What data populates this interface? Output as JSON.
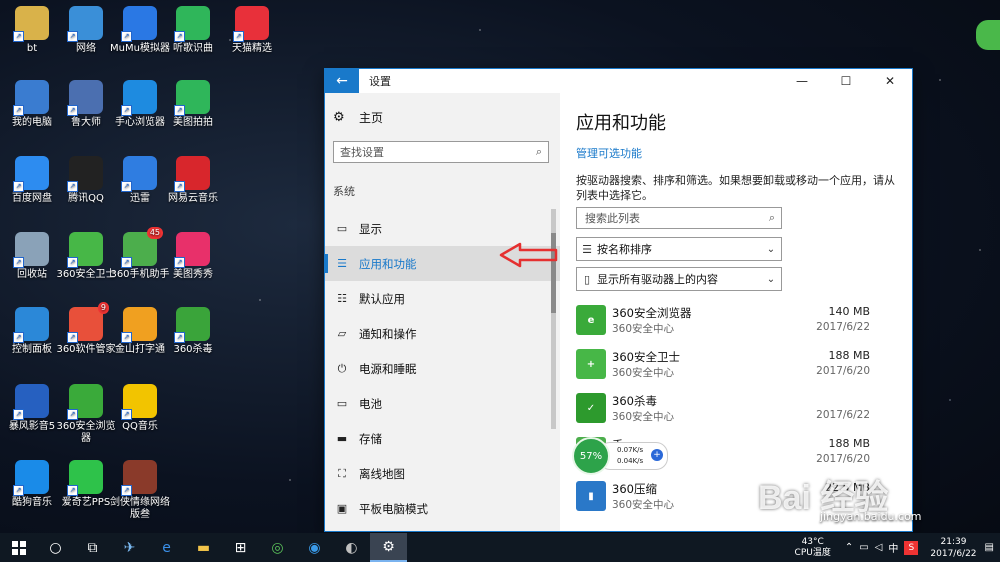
{
  "desktop_icons": [
    {
      "label": "bt",
      "color": "#d9b24a",
      "x": 0,
      "y": 0
    },
    {
      "label": "网络",
      "color": "#3a8fd8"
    },
    {
      "label": "MuMu模拟器",
      "color": "#2a78e4"
    },
    {
      "label": "听歌识曲",
      "color": "#2fb65a"
    },
    {
      "label": "天猫精选",
      "color": "#e8303a"
    },
    {
      "label": "我的电脑",
      "color": "#3a7cd0"
    },
    {
      "label": "鲁大师",
      "color": "#4b6fb0"
    },
    {
      "label": "手心浏览器",
      "color": "#1e8be0"
    },
    {
      "label": "美图拍拍",
      "color": "#2fb65a"
    },
    {
      "label": "百度网盘",
      "color": "#2d8cf0"
    },
    {
      "label": "腾讯QQ",
      "color": "#222222"
    },
    {
      "label": "迅雷",
      "color": "#2f7de1"
    },
    {
      "label": "网易云音乐",
      "color": "#d8262c"
    },
    {
      "label": "回收站",
      "color": "#8aa2b8"
    },
    {
      "label": "360安全卫士",
      "color": "#47b747"
    },
    {
      "label": "360手机助手",
      "color": "#4cae4c",
      "badge": "45"
    },
    {
      "label": "美图秀秀",
      "color": "#e8306a"
    },
    {
      "label": "控制面板",
      "color": "#2b88d8"
    },
    {
      "label": "360软件管家",
      "color": "#e8503a",
      "badge": "9"
    },
    {
      "label": "金山打字通",
      "color": "#f0a020"
    },
    {
      "label": "360杀毒",
      "color": "#3aa43a"
    },
    {
      "label": "暴风影音5",
      "color": "#2660c0"
    },
    {
      "label": "360安全浏览器",
      "color": "#3aaa3a"
    },
    {
      "label": "QQ音乐",
      "color": "#f2c400"
    },
    {
      "label": "酷狗音乐",
      "color": "#1a8be8"
    },
    {
      "label": "爱奇艺PPS",
      "color": "#2ec24a"
    },
    {
      "label": "剑侠情缘网络版叁",
      "color": "#8a3a2a"
    }
  ],
  "window": {
    "title": "设置",
    "back_icon": "←",
    "minimize": "—",
    "maximize": "☐",
    "close": "✕"
  },
  "sidebar": {
    "home_label": "主页",
    "search_placeholder": "查找设置",
    "section": "系统",
    "items": [
      {
        "label": "显示",
        "icon": "display-icon",
        "glyph": "▭"
      },
      {
        "label": "应用和功能",
        "icon": "apps-list-icon",
        "glyph": "☰",
        "active": true
      },
      {
        "label": "默认应用",
        "icon": "default-apps-icon",
        "glyph": "☷"
      },
      {
        "label": "通知和操作",
        "icon": "notification-icon",
        "glyph": "▱"
      },
      {
        "label": "电源和睡眠",
        "icon": "power-icon",
        "glyph": "⏻"
      },
      {
        "label": "电池",
        "icon": "battery-icon",
        "glyph": "▭"
      },
      {
        "label": "存储",
        "icon": "storage-icon",
        "glyph": "▬"
      },
      {
        "label": "离线地图",
        "icon": "map-icon",
        "glyph": "⛶"
      },
      {
        "label": "平板电脑模式",
        "icon": "tablet-icon",
        "glyph": "▣"
      }
    ]
  },
  "main": {
    "heading": "应用和功能",
    "manage_link": "管理可选功能",
    "description": "按驱动器搜索、排序和筛选。如果想要卸载或移动一个应用，请从列表中选择它。",
    "search_placeholder": "搜索此列表",
    "sort_label": "按名称排序",
    "drive_filter_label": "显示所有驱动器上的内容",
    "apps": [
      {
        "name": "360安全浏览器",
        "publisher": "360安全中心",
        "size": "140 MB",
        "date": "2017/6/22",
        "color": "#3aaa3a",
        "icon": "e"
      },
      {
        "name": "360安全卫士",
        "publisher": "360安全中心",
        "size": "188 MB",
        "date": "2017/6/20",
        "color": "#47b747",
        "icon": "+"
      },
      {
        "name": "360杀毒",
        "publisher": "360安全中心",
        "size": "",
        "date": "2017/6/22",
        "color": "#2d9a2d",
        "icon": "✓"
      },
      {
        "name": "手",
        "publisher": "",
        "size": "188 MB",
        "date": "2017/6/20",
        "color": "#4cae4c",
        "icon": ""
      },
      {
        "name": "360压缩",
        "publisher": "360安全中心",
        "size": "22.5 MB",
        "date": "",
        "color": "#2a78c8",
        "icon": "▮"
      }
    ]
  },
  "widget": {
    "percent": "57%",
    "up": "0.07K/s",
    "down": "0.04K/s",
    "plus": "+"
  },
  "watermark": {
    "main": "Bai 经验",
    "sub": "jingyan.baidu.com"
  },
  "taskbar": {
    "cpu_temp": "43°C",
    "cpu_label": "CPU温度",
    "ime": "中",
    "time": "21:39",
    "date": "2017/6/22"
  }
}
